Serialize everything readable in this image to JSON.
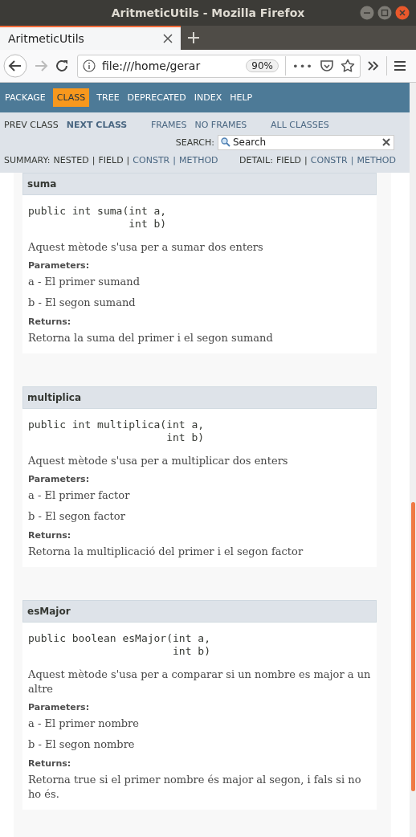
{
  "window": {
    "title": "AritmeticUtils - Mozilla Firefox"
  },
  "tabs": [
    {
      "label": "AritmeticUtils",
      "selected": true
    }
  ],
  "toolbar": {
    "back_disabled": false,
    "forward_disabled": true,
    "url": "file:///home/gerar",
    "zoom": "90%",
    "overflow": "•••"
  },
  "nav": {
    "items": [
      {
        "label": "PACKAGE",
        "selected": false
      },
      {
        "label": "CLASS",
        "selected": true
      },
      {
        "label": "TREE",
        "selected": false
      },
      {
        "label": "DEPRECATED",
        "selected": false
      },
      {
        "label": "INDEX",
        "selected": false
      },
      {
        "label": "HELP",
        "selected": false
      }
    ]
  },
  "subnav": {
    "groups": [
      [
        {
          "label": "PREV CLASS",
          "kind": "plain"
        },
        {
          "label": "NEXT CLASS",
          "kind": "strong"
        }
      ],
      [
        {
          "label": "FRAMES",
          "kind": "link"
        },
        {
          "label": "NO FRAMES",
          "kind": "link"
        }
      ],
      [
        {
          "label": "ALL CLASSES",
          "kind": "link"
        }
      ]
    ],
    "search": {
      "label": "SEARCH:",
      "placeholder": "Search"
    },
    "summary": {
      "label": "SUMMARY:",
      "items": [
        {
          "label": "NESTED",
          "link": false
        },
        {
          "label": "|",
          "link": false
        },
        {
          "label": "FIELD",
          "link": false
        },
        {
          "label": "|",
          "link": false
        },
        {
          "label": "CONSTR",
          "link": true
        },
        {
          "label": "|",
          "link": true
        },
        {
          "label": "METHOD",
          "link": true
        }
      ]
    },
    "detail": {
      "label": "DETAIL:",
      "items": [
        {
          "label": "FIELD",
          "link": false
        },
        {
          "label": "|",
          "link": false
        },
        {
          "label": "CONSTR",
          "link": true
        },
        {
          "label": "|",
          "link": true
        },
        {
          "label": "METHOD",
          "link": true
        }
      ]
    }
  },
  "methods": [
    {
      "name": "suma",
      "signature": "public int suma(int a,\n                int b)",
      "description": "Aquest mètode s'usa per a sumar dos enters",
      "parameters_label": "Parameters:",
      "parameters": [
        "a - El primer sumand",
        "b - El segon sumand"
      ],
      "returns_label": "Returns:",
      "returns": "Retorna la suma del primer i el segon sumand"
    },
    {
      "name": "multiplica",
      "signature": "public int multiplica(int a,\n                      int b)",
      "description": "Aquest mètode s'usa per a multiplicar dos enters",
      "parameters_label": "Parameters:",
      "parameters": [
        "a - El primer factor",
        "b - El segon factor"
      ],
      "returns_label": "Returns:",
      "returns": "Retorna la multiplicació del primer i el segon factor"
    },
    {
      "name": "esMajor",
      "signature": "public boolean esMajor(int a,\n                       int b)",
      "description": "Aquest mètode s'usa per a comparar si un nombre es major a un altre",
      "parameters_label": "Parameters:",
      "parameters": [
        "a - El primer nombre",
        "b - El segon nombre"
      ],
      "returns_label": "Returns:",
      "returns": "Retorna true si el primer nombre és major al segon, i fals si no ho és."
    }
  ]
}
